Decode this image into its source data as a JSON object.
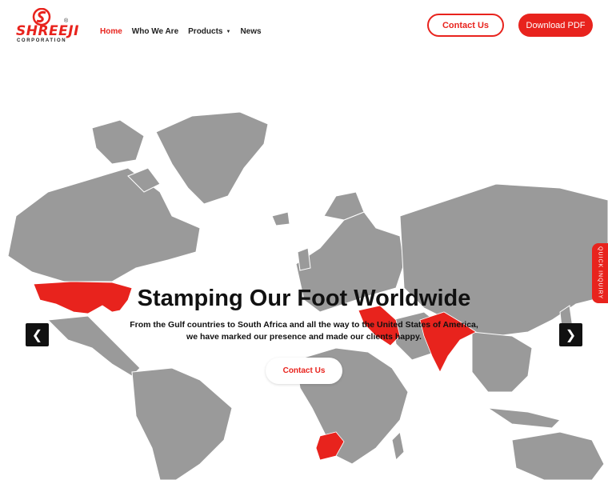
{
  "brand": {
    "name": "SHREEJI",
    "sub": "CORPORATION",
    "reg": "®",
    "color": "#e8231d"
  },
  "nav": {
    "items": [
      {
        "label": "Home",
        "active": true
      },
      {
        "label": "Who We Are",
        "active": false
      },
      {
        "label": "Products",
        "active": false,
        "dropdown": true
      },
      {
        "label": "News",
        "active": false
      }
    ]
  },
  "header": {
    "contact_label": "Contact Us",
    "download_label": "Download PDF"
  },
  "hero": {
    "title": "Stamping Our Foot Worldwide",
    "line1": "From the Gulf countries to South Africa and all the way to the United States of America,",
    "line2": "we have marked our presence and made our clients happy.",
    "cta_label": "Contact Us",
    "prev_icon": "chevron-left-icon",
    "next_icon": "chevron-right-icon",
    "highlight_regions": [
      "United States of America",
      "Gulf countries",
      "India",
      "South Africa"
    ],
    "map_gray": "#9a9a9a",
    "map_red": "#e8231d"
  },
  "quick_inquiry": {
    "label": "QUICK INQUIRY"
  }
}
